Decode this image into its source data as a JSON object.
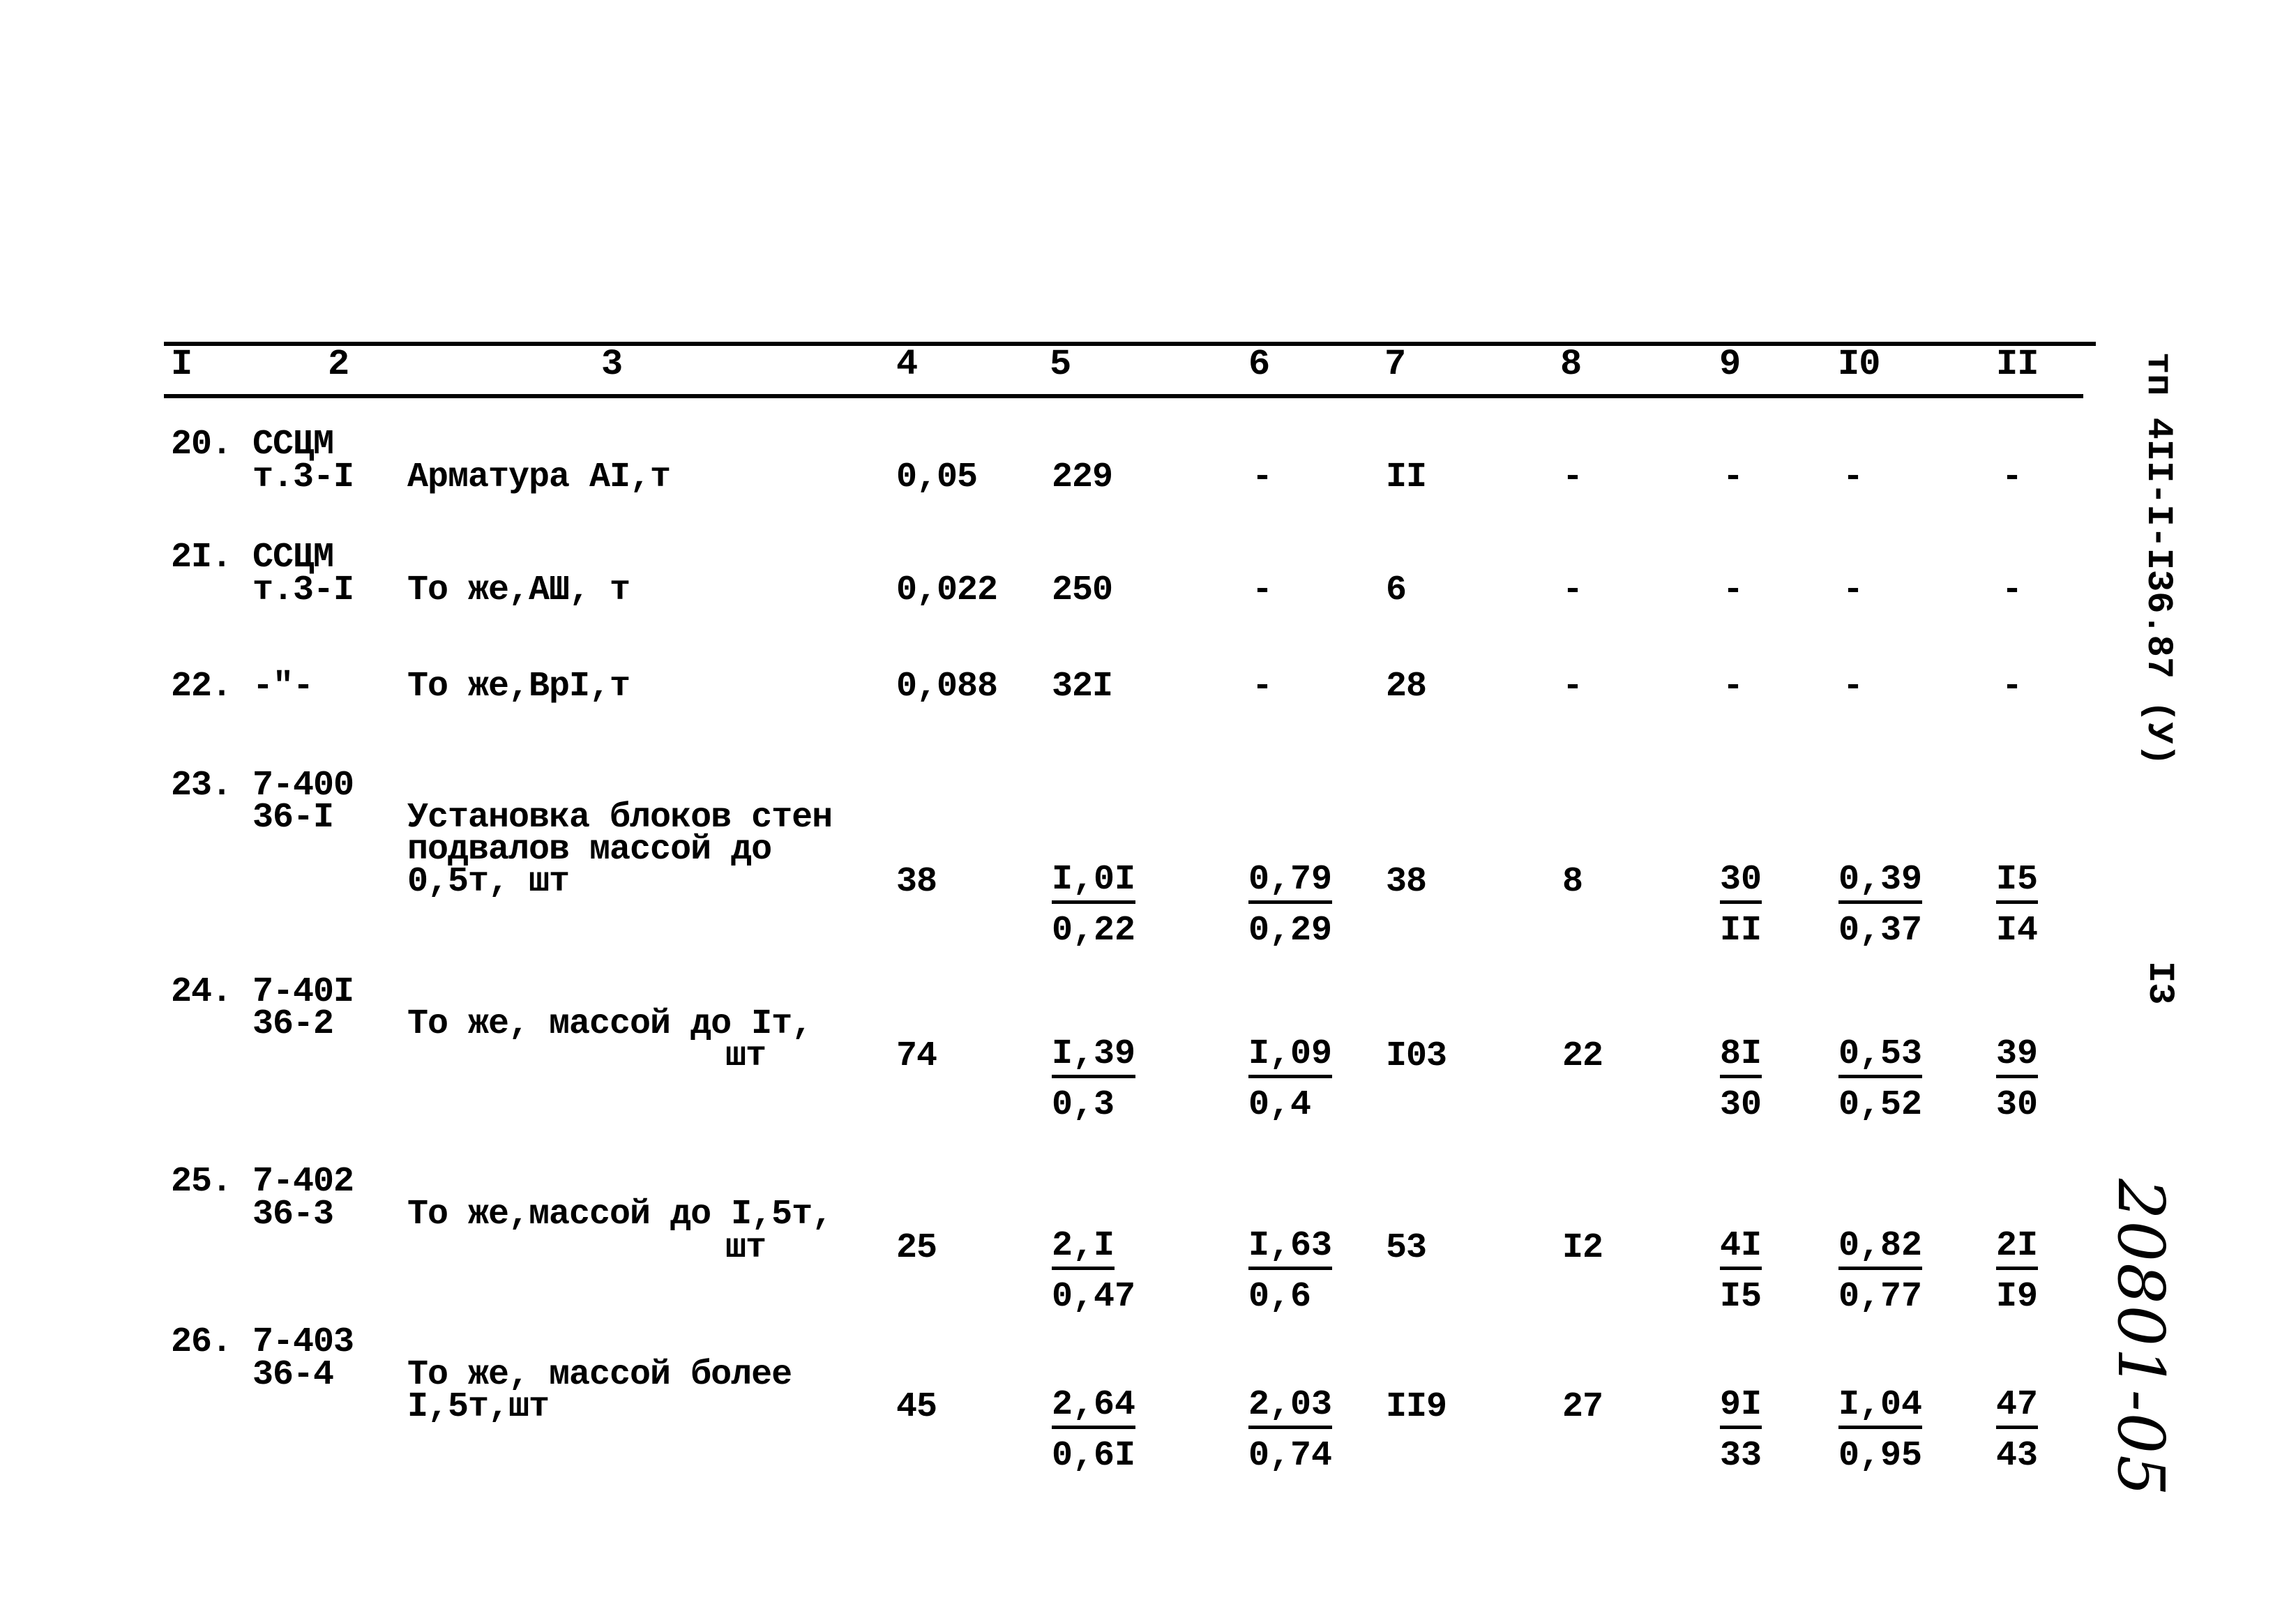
{
  "document": {
    "side_code": "тп 4II-I-I36.87 (У)",
    "page_number": "I3",
    "handwritten_mark": "20801-05"
  },
  "table": {
    "column_headers": [
      "I",
      "2",
      "3",
      "4",
      "5",
      "6",
      "7",
      "8",
      "9",
      "I0",
      "II"
    ],
    "rows": [
      {
        "num": "20.",
        "code": [
          "ССЦМ",
          "т.3-I"
        ],
        "desc": [
          "Арматура АI,т"
        ],
        "c4": "0,05",
        "c5": {
          "top": "229",
          "bottom": ""
        },
        "c6": {
          "top": "-",
          "bottom": ""
        },
        "c7": "II",
        "c8": "-",
        "c9": {
          "top": "-",
          "bottom": ""
        },
        "c10": {
          "top": "-",
          "bottom": ""
        },
        "c11": {
          "top": "-",
          "bottom": ""
        }
      },
      {
        "num": "2I.",
        "code": [
          "ССЦМ",
          "т.3-I"
        ],
        "desc": [
          "То же,АШ, т"
        ],
        "c4": "0,022",
        "c5": {
          "top": "250",
          "bottom": ""
        },
        "c6": {
          "top": "-",
          "bottom": ""
        },
        "c7": "6",
        "c8": "-",
        "c9": {
          "top": "-",
          "bottom": ""
        },
        "c10": {
          "top": "-",
          "bottom": ""
        },
        "c11": {
          "top": "-",
          "bottom": ""
        }
      },
      {
        "num": "22.",
        "code": [
          "-\"-"
        ],
        "desc": [
          "То же,ВрI,т"
        ],
        "c4": "0,088",
        "c5": {
          "top": "32I",
          "bottom": ""
        },
        "c6": {
          "top": "-",
          "bottom": ""
        },
        "c7": "28",
        "c8": "-",
        "c9": {
          "top": "-",
          "bottom": ""
        },
        "c10": {
          "top": "-",
          "bottom": ""
        },
        "c11": {
          "top": "-",
          "bottom": ""
        }
      },
      {
        "num": "23.",
        "code": [
          "7-400",
          "36-I"
        ],
        "desc": [
          "Установка блоков стен",
          "подвалов массой до",
          "0,5т, шт"
        ],
        "c4": "38",
        "c5": {
          "top": "I,0I",
          "bottom": "0,22"
        },
        "c6": {
          "top": "0,79",
          "bottom": "0,29"
        },
        "c7": "38",
        "c8": "8",
        "c9": {
          "top": "30",
          "bottom": "II"
        },
        "c10": {
          "top": "0,39",
          "bottom": "0,37"
        },
        "c11": {
          "top": "I5",
          "bottom": "I4"
        }
      },
      {
        "num": "24.",
        "code": [
          "7-40I",
          "36-2"
        ],
        "desc": [
          "То же, массой до Iт,",
          "шт"
        ],
        "c4": "74",
        "c5": {
          "top": "I,39",
          "bottom": "0,3"
        },
        "c6": {
          "top": "I,09",
          "bottom": "0,4"
        },
        "c7": "I03",
        "c8": "22",
        "c9": {
          "top": "8I",
          "bottom": "30"
        },
        "c10": {
          "top": "0,53",
          "bottom": "0,52"
        },
        "c11": {
          "top": "39",
          "bottom": "30"
        }
      },
      {
        "num": "25.",
        "code": [
          "7-402",
          "36-3"
        ],
        "desc": [
          "То же,массой до I,5т,",
          "шт"
        ],
        "c4": "25",
        "c5": {
          "top": "2,I",
          "bottom": "0,47"
        },
        "c6": {
          "top": "I,63",
          "bottom": "0,6"
        },
        "c7": "53",
        "c8": "I2",
        "c9": {
          "top": "4I",
          "bottom": "I5"
        },
        "c10": {
          "top": "0,82",
          "bottom": "0,77"
        },
        "c11": {
          "top": "2I",
          "bottom": "I9"
        }
      },
      {
        "num": "26.",
        "code": [
          "7-403",
          "36-4"
        ],
        "desc": [
          "То же, массой более",
          "I,5т,шт"
        ],
        "c4": "45",
        "c5": {
          "top": "2,64",
          "bottom": "0,6I"
        },
        "c6": {
          "top": "2,03",
          "bottom": "0,74"
        },
        "c7": "II9",
        "c8": "27",
        "c9": {
          "top": "9I",
          "bottom": "33"
        },
        "c10": {
          "top": "I,04",
          "bottom": "0,95"
        },
        "c11": {
          "top": "47",
          "bottom": "43"
        }
      }
    ]
  }
}
